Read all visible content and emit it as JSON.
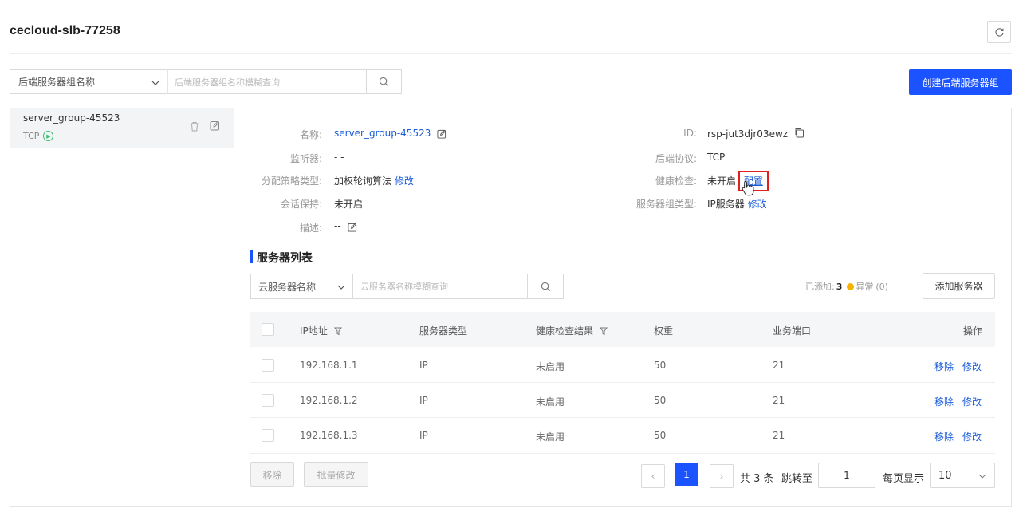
{
  "header": {
    "title": "cecloud-slb-77258",
    "refresh_icon": "refresh-icon"
  },
  "group_filter": {
    "select_value": "后端服务器组名称",
    "search_placeholder": "后端服务器组名称模糊查询",
    "create_label": "创建后端服务器组"
  },
  "sidebar": {
    "items": [
      {
        "name": "server_group-45523",
        "protocol": "TCP"
      }
    ]
  },
  "detail": {
    "name_label": "名称:",
    "name_value": "server_group-45523",
    "listener_label": "监听器:",
    "listener_value": "- -",
    "strategy_label": "分配策略类型:",
    "strategy_value": "加权轮询算法",
    "strategy_link": "修改",
    "session_label": "会话保持:",
    "session_value": "未开启",
    "desc_label": "描述:",
    "desc_value": "--",
    "id_label": "ID:",
    "id_value": "rsp-jut3djr03ewz",
    "proto_label": "后端协议:",
    "proto_value": "TCP",
    "health_label": "健康检查:",
    "health_value": "未开启",
    "health_link": "配置",
    "type_label": "服务器组类型:",
    "type_value": "IP服务器",
    "type_link": "修改"
  },
  "server_list": {
    "title": "服务器列表",
    "select_value": "云服务器名称",
    "search_placeholder": "云服务器名称模糊查询",
    "added_label": "已添加:",
    "added_count": "3",
    "abnormal_label": "异常",
    "abnormal_count": "(0)",
    "add_label": "添加服务器",
    "columns": [
      "IP地址",
      "服务器类型",
      "健康检查结果",
      "权重",
      "业务端口",
      "操作"
    ],
    "rows": [
      {
        "ip": "192.168.1.1",
        "type": "IP",
        "health": "未启用",
        "weight": "50",
        "port": "21",
        "remove": "移除",
        "edit": "修改"
      },
      {
        "ip": "192.168.1.2",
        "type": "IP",
        "health": "未启用",
        "weight": "50",
        "port": "21",
        "remove": "移除",
        "edit": "修改"
      },
      {
        "ip": "192.168.1.3",
        "type": "IP",
        "health": "未启用",
        "weight": "50",
        "port": "21",
        "remove": "移除",
        "edit": "修改"
      }
    ]
  },
  "footer": {
    "remove_label": "移除",
    "batch_label": "批量修改",
    "prev": "‹",
    "page": "1",
    "next": "›",
    "total_text": "共 3 条",
    "jump_label": "跳转至",
    "jump_value": "1",
    "per_page_label": "每页显示",
    "per_page_value": "10"
  },
  "colors": {
    "accent": "#1a53ff",
    "link": "#1a5bd8",
    "highlight": "#e02020",
    "warn": "#f5b400",
    "ok": "#3bbf6f"
  }
}
